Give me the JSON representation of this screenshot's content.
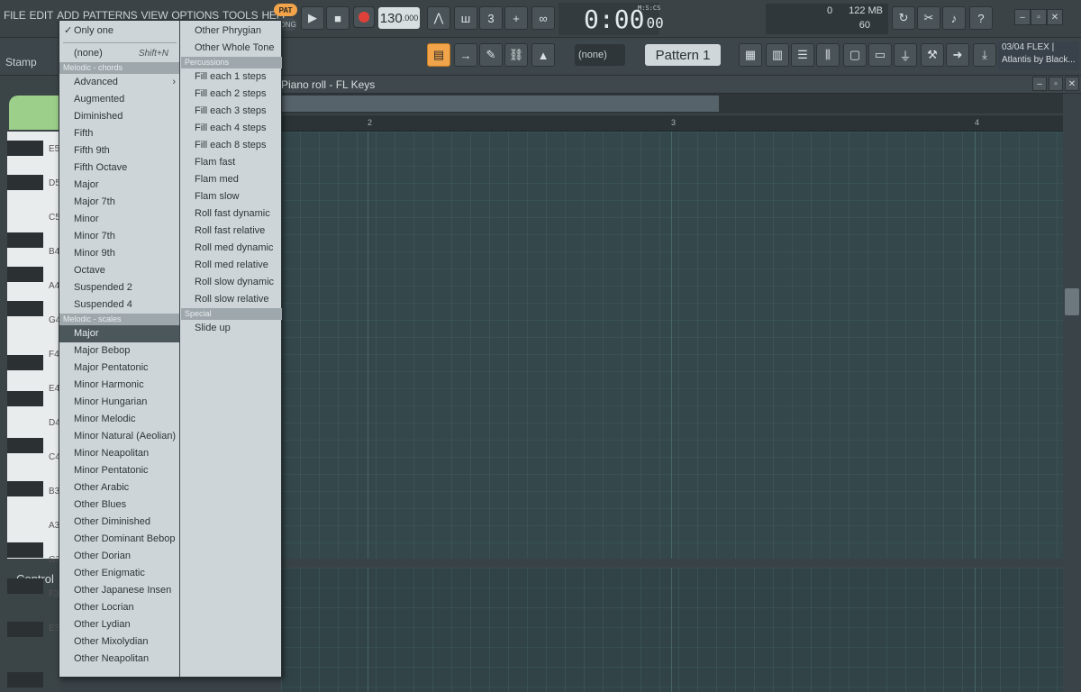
{
  "menu_bar": [
    "FILE",
    "EDIT",
    "ADD",
    "PATTERNS",
    "VIEW",
    "OPTIONS",
    "TOOLS",
    "HELP"
  ],
  "stamp_label": "Stamp",
  "transport": {
    "pat_label": "PAT",
    "song_label": "SONG",
    "play_icon": "▶",
    "stop_icon": "■",
    "tempo": "130",
    "tempo_decimal": ".000"
  },
  "time": {
    "main": "0:00",
    "sub": "00",
    "format": "M:S:CS"
  },
  "meters": {
    "cpu": "0",
    "memory": "122 MB",
    "polyphony": "60"
  },
  "pattern": {
    "snap": "(none)",
    "name": "Pattern 1",
    "plus": "+"
  },
  "info": {
    "line1": "03/04  FLEX |",
    "line2": "Atlantis by Black..."
  },
  "piano_roll": {
    "title": "Piano roll - FL Keys",
    "control_label": "Control",
    "bars": [
      "2",
      "3",
      "4"
    ]
  },
  "piano_keys": [
    "E5",
    "D5",
    "C5",
    "B4",
    "A4",
    "G4",
    "F4",
    "E4",
    "D4",
    "C4",
    "B3",
    "A3",
    "G3",
    "F3",
    "E3"
  ],
  "stamp_menu": {
    "only_one": "Only one",
    "none": "(none)",
    "none_shortcut": "Shift+N",
    "header_chords": "Melodic - chords",
    "chords": [
      "Advanced",
      "Augmented",
      "Diminished",
      "Fifth",
      "Fifth 9th",
      "Fifth Octave",
      "Major",
      "Major 7th",
      "Minor",
      "Minor 7th",
      "Minor 9th",
      "Octave",
      "Suspended 2",
      "Suspended 4"
    ],
    "header_scales": "Melodic - scales",
    "scales": [
      "Major",
      "Major Bebop",
      "Major Pentatonic",
      "Minor Harmonic",
      "Minor Hungarian",
      "Minor Melodic",
      "Minor Natural (Aeolian)",
      "Minor Neapolitan",
      "Minor Pentatonic",
      "Other Arabic",
      "Other Blues",
      "Other Diminished",
      "Other Dominant Bebop",
      "Other Dorian",
      "Other Enigmatic",
      "Other Japanese Insen",
      "Other Locrian",
      "Other Lydian",
      "Other Mixolydian",
      "Other Neapolitan"
    ],
    "scales_col2": [
      "Other Phrygian",
      "Other Whole Tone"
    ],
    "header_percussions": "Percussions",
    "percussions": [
      "Fill each 1 steps",
      "Fill each 2 steps",
      "Fill each 3 steps",
      "Fill each 4 steps",
      "Fill each 8 steps",
      "Flam fast",
      "Flam med",
      "Flam slow",
      "Roll fast dynamic",
      "Roll fast relative",
      "Roll med dynamic",
      "Roll med relative",
      "Roll slow dynamic",
      "Roll slow relative"
    ],
    "header_special": "Special",
    "special": [
      "Slide up"
    ]
  }
}
